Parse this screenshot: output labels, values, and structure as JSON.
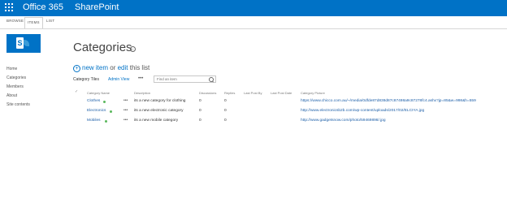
{
  "suitebar": {
    "brand": "Office 365",
    "app": "SharePoint",
    "waffle_icon": "app-launcher-icon",
    "color": "#0072c6"
  },
  "ribbon": {
    "tabs": [
      "BROWSE",
      "ITEMS",
      "LIST"
    ],
    "selected": "ITEMS"
  },
  "logo": {
    "letter": "S",
    "icon": "sharepoint-logo-icon"
  },
  "nav": {
    "items": [
      "Home",
      "Categories",
      "Members",
      "About",
      "Site contents"
    ]
  },
  "page": {
    "title": "Categories",
    "info_icon": "info-icon"
  },
  "actions": {
    "new_item": "new item",
    "or": "or",
    "edit": "edit",
    "this_list": "this list"
  },
  "views": {
    "tiles": "Category Tiles",
    "admin": "Admin View",
    "ellipsis": "•••"
  },
  "search": {
    "placeholder": "Find an item"
  },
  "table": {
    "columns": [
      "Category Name",
      "Description",
      "Discussions",
      "Replies",
      "Last Post By",
      "Last Post Date",
      "Category Picture"
    ],
    "check_icon": "✓",
    "rows": [
      {
        "name": "Clothes",
        "description": "its a new category for clothing",
        "discussions": "0",
        "replies": "0",
        "picture": "https://www.chicco.com.au/~/media/0dfde87d838d87c87498a9c87278fc4.ashx?jp=85&w=998&h=559"
      },
      {
        "name": "Electronics",
        "description": "its a new electronic category",
        "discussions": "0",
        "replies": "0",
        "picture": "http://www.electronicsb2b.com/wp-content/uploads/2017/02/ELCIYA.jpg"
      },
      {
        "name": "Mobiles",
        "description": "its a new mobile category",
        "discussions": "0",
        "replies": "0",
        "picture": "http://www.gadgetsnow.com/photo/59469898/.jpg"
      }
    ]
  }
}
